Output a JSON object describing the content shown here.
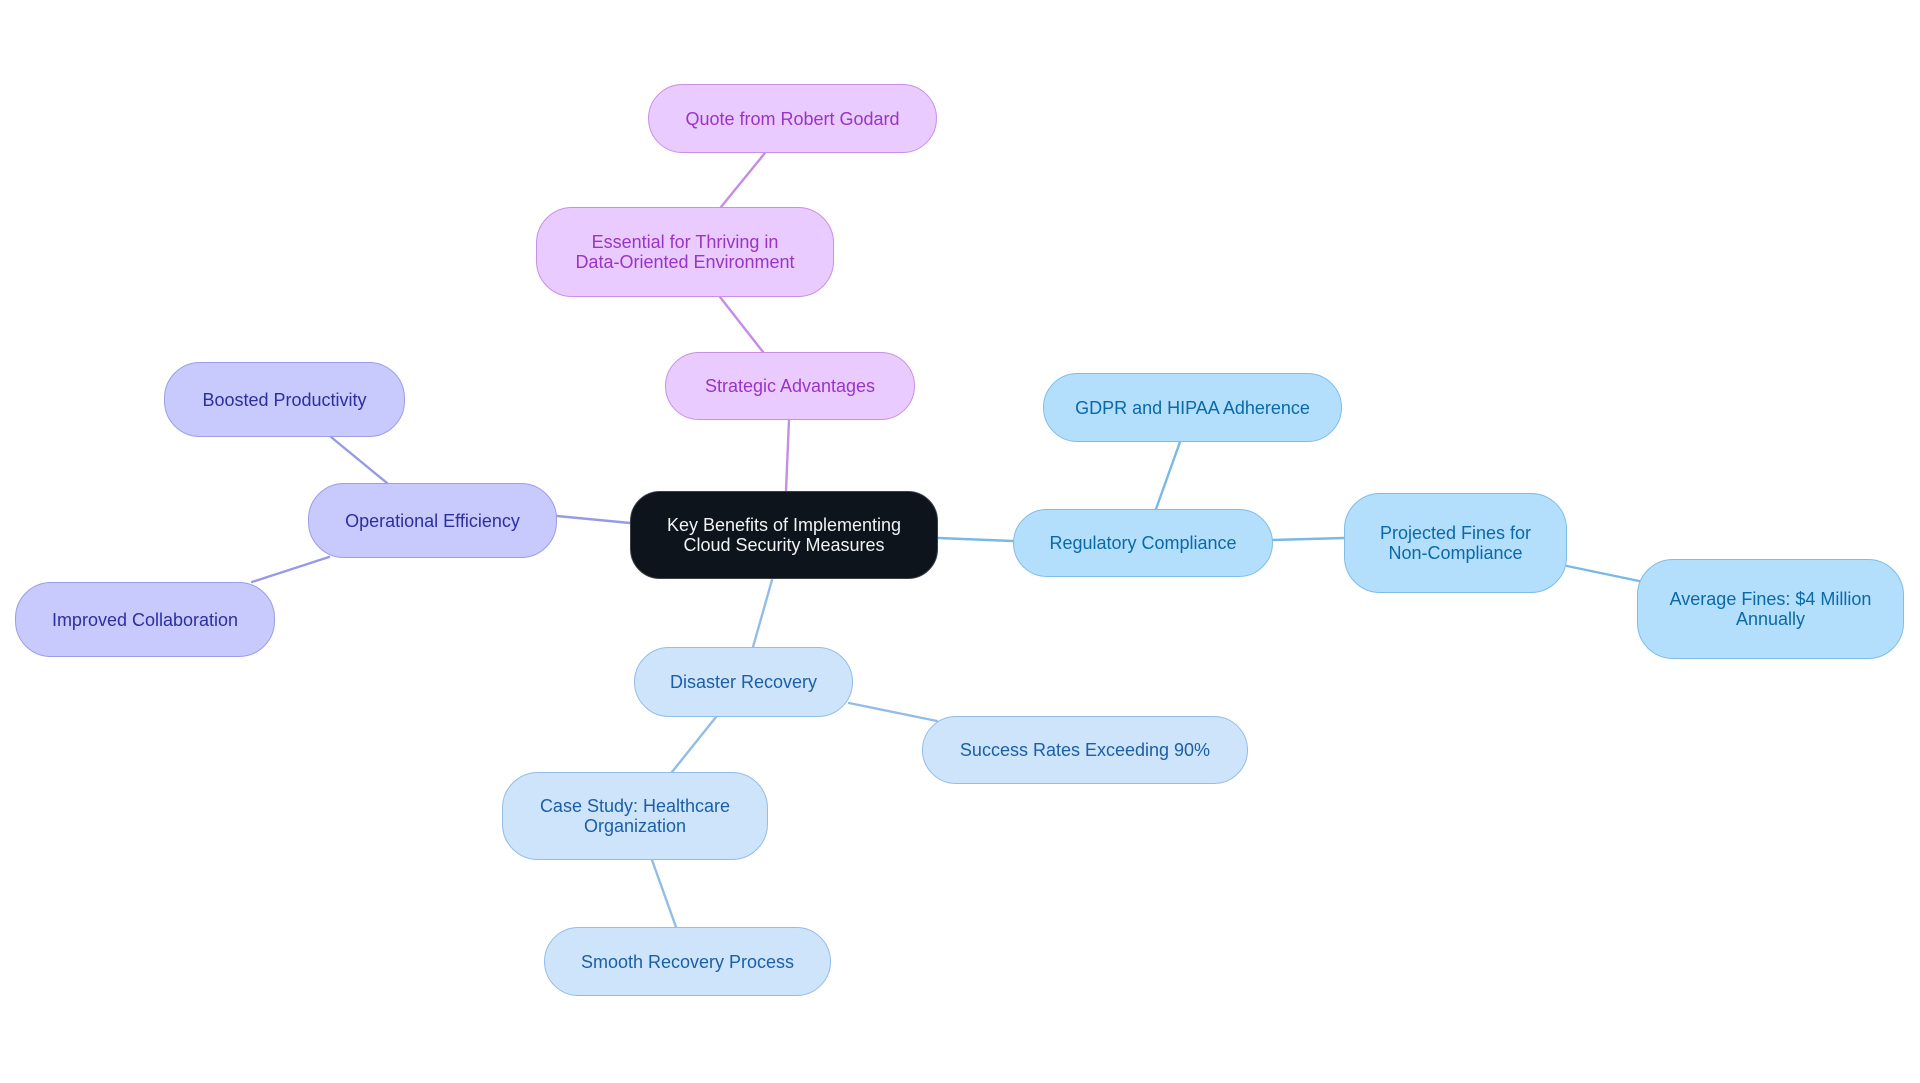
{
  "diagram": {
    "type": "mindmap",
    "root": {
      "id": "root",
      "label": "Key Benefits of Implementing\nCloud Security Measures"
    },
    "colors": {
      "root_fill": "#0d141b",
      "root_text": "#f1f3f5",
      "purple_fill": "#eacbff",
      "purple_edge": "#c58de6",
      "purple_text": "#9a34c6",
      "indigo_fill": "#c8c9fd",
      "indigo_edge": "#989be4",
      "indigo_text": "#2c2f9f",
      "sky_fill": "#b3defc",
      "sky_edge": "#7ab9e6",
      "sky_text": "#0a6aa8",
      "pale_fill": "#cde4fb",
      "pale_edge": "#93bde6",
      "pale_text": "#1b5fa6"
    },
    "nodes": {
      "strategic": {
        "label": "Strategic Advantages",
        "parent": "root",
        "theme": "purple"
      },
      "essential": {
        "label": "Essential for Thriving in\nData-Oriented Environment",
        "parent": "strategic",
        "theme": "purple"
      },
      "quote": {
        "label": "Quote from Robert Godard",
        "parent": "essential",
        "theme": "purple"
      },
      "operational": {
        "label": "Operational Efficiency",
        "parent": "root",
        "theme": "indigo"
      },
      "boosted": {
        "label": "Boosted Productivity",
        "parent": "operational",
        "theme": "indigo"
      },
      "improved": {
        "label": "Improved Collaboration",
        "parent": "operational",
        "theme": "indigo"
      },
      "regulatory": {
        "label": "Regulatory Compliance",
        "parent": "root",
        "theme": "sky"
      },
      "gdpr": {
        "label": "GDPR and HIPAA Adherence",
        "parent": "regulatory",
        "theme": "sky"
      },
      "projected": {
        "label": "Projected Fines for\nNon-Compliance",
        "parent": "regulatory",
        "theme": "sky"
      },
      "average": {
        "label": "Average Fines: $4 Million\nAnnually",
        "parent": "projected",
        "theme": "sky"
      },
      "disaster": {
        "label": "Disaster Recovery",
        "parent": "root",
        "theme": "pale"
      },
      "success": {
        "label": "Success Rates Exceeding 90%",
        "parent": "disaster",
        "theme": "pale"
      },
      "casestudy": {
        "label": "Case Study: Healthcare\nOrganization",
        "parent": "disaster",
        "theme": "pale"
      },
      "smooth": {
        "label": "Smooth Recovery Process",
        "parent": "casestudy",
        "theme": "pale"
      }
    }
  }
}
